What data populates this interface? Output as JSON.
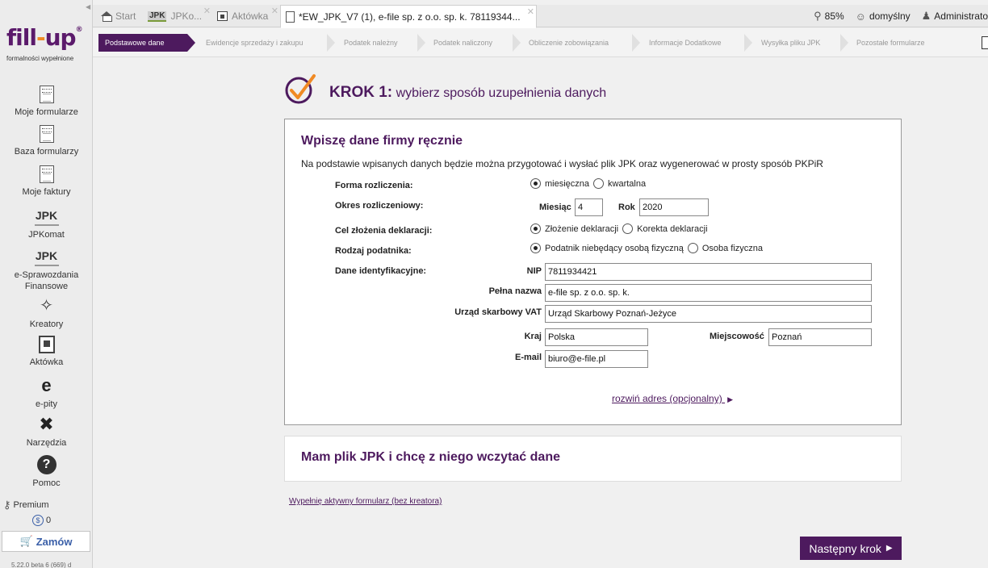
{
  "topbar": {
    "tabs": [
      {
        "label": "Start",
        "icon": "home-icon"
      },
      {
        "label": "JPKo...",
        "icon": "jpk-icon"
      },
      {
        "label": "Aktówka",
        "icon": "briefcase-icon"
      },
      {
        "label": "*EW_JPK_V7 (1), e-file sp. z o.o. sp. k. 78119344...",
        "icon": "document-icon"
      }
    ],
    "zoom": "85%",
    "profile": "domyślny",
    "user": "Administrato"
  },
  "sidebar": {
    "logo_main": "fill",
    "logo_dash": "-",
    "logo_end": "up",
    "logo_reg": "®",
    "logo_tagline": "formalności wypełnione",
    "items": [
      {
        "label": "Moje formularze",
        "icon": "forms-icon"
      },
      {
        "label": "Baza formularzy",
        "icon": "forms-base-icon"
      },
      {
        "label": "Moje faktury",
        "icon": "invoice-icon"
      },
      {
        "label": "JPKomat",
        "icon": "jpk-icon",
        "icon_text": "JPK"
      },
      {
        "label": "e-Sprawozdania Finansowe",
        "icon": "jpk-icon",
        "icon_text": "JPK"
      },
      {
        "label": "Kreatory",
        "icon": "wand-icon"
      },
      {
        "label": "Aktówka",
        "icon": "briefcase-icon"
      },
      {
        "label": "e-pity",
        "icon": "e-pity-icon",
        "icon_text": "e"
      },
      {
        "label": "Narzędzia",
        "icon": "tools-icon"
      },
      {
        "label": "Pomoc",
        "icon": "help-icon",
        "icon_text": "?"
      }
    ],
    "premium": "Premium",
    "coins": "0",
    "order": "Zamów",
    "version": "5.22.0 beta 6 (669) d"
  },
  "steps": [
    "Podstawowe dane",
    "Ewidencje sprzedaży i zakupu",
    "Podatek należny",
    "Podatek naliczony",
    "Obliczenie zobowiązania",
    "Informacje Dodatkowe",
    "Wysyłka pliku JPK",
    "Pozostałe formularze"
  ],
  "main": {
    "step_prefix": "KROK 1:",
    "step_title": "wybierz sposób uzupełnienia danych",
    "manual": {
      "heading": "Wpiszę dane firmy ręcznie",
      "description": "Na podstawie wpisanych danych będzie można przygotować i wysłać plik JPK oraz wygenerować w prosty sposób PKPiR",
      "forma_label": "Forma rozliczenia:",
      "forma_opt1": "miesięczna",
      "forma_opt2": "kwartalna",
      "okres_label": "Okres rozliczeniowy:",
      "miesiac_label": "Miesiąc",
      "miesiac_value": "4",
      "rok_label": "Rok",
      "rok_value": "2020",
      "cel_label": "Cel złożenia deklaracji:",
      "cel_opt1": "Złożenie deklaracji",
      "cel_opt2": "Korekta deklaracji",
      "rodzaj_label": "Rodzaj podatnika:",
      "rodzaj_opt1": "Podatnik niebędący osobą fizyczną",
      "rodzaj_opt2": "Osoba fizyczna",
      "dane_label": "Dane identyfikacyjne:",
      "nip_label": "NIP",
      "nip_value": "7811934421",
      "nazwa_label": "Pełna nazwa",
      "nazwa_value": "e-file sp. z o.o. sp. k.",
      "urzad_label": "Urząd skarbowy VAT",
      "urzad_value": "Urząd Skarbowy Poznań-Jeżyce",
      "kraj_label": "Kraj",
      "kraj_value": "Polska",
      "miejscowosc_label": "Miejscowość",
      "miejscowosc_value": "Poznań",
      "email_label": "E-mail",
      "email_value": "biuro@e-file.pl",
      "expand_link": "rozwiń adres (opcjonalny)"
    },
    "jpk_file_heading": "Mam plik JPK i chcę z niego wczytać dane",
    "no_wizard_link": "Wypełnię aktywny formularz (bez kreatora)",
    "next_button": "Następny krok"
  }
}
